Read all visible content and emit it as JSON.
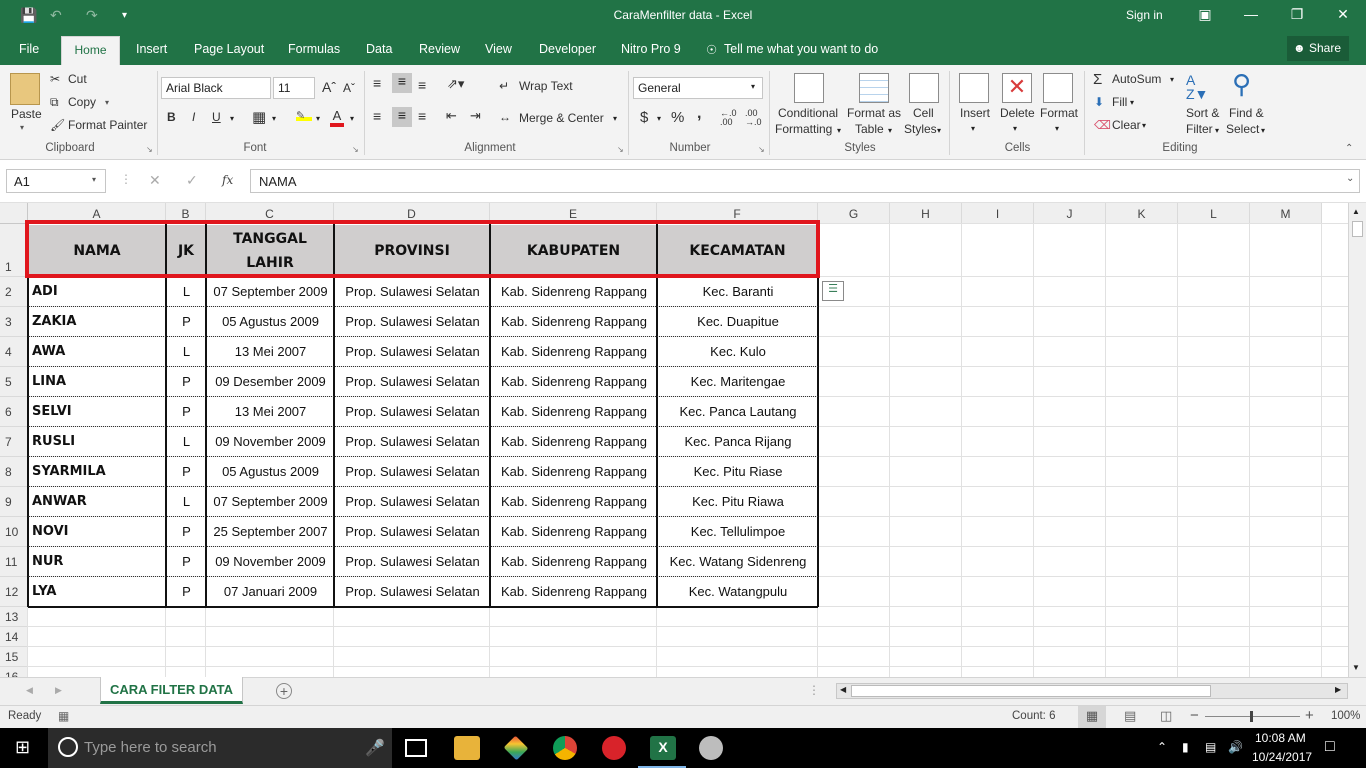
{
  "window": {
    "title": "CaraMenfilter data  -  Excel",
    "sign_in": "Sign in"
  },
  "tabs": [
    "File",
    "Home",
    "Insert",
    "Page Layout",
    "Formulas",
    "Data",
    "Review",
    "View",
    "Developer",
    "Nitro Pro 9"
  ],
  "tell_me": "Tell me what you want to do",
  "share": "Share",
  "ribbon": {
    "clipboard": {
      "paste": "Paste",
      "cut": "Cut",
      "copy": "Copy",
      "format_painter": "Format Painter",
      "label": "Clipboard"
    },
    "font": {
      "name": "Arial Black",
      "size": "11",
      "bold": "B",
      "italic": "I",
      "underline": "U",
      "label": "Font"
    },
    "alignment": {
      "wrap_text": "Wrap Text",
      "merge_center": "Merge & Center",
      "label": "Alignment"
    },
    "number": {
      "format": "General",
      "currency": "$",
      "percent": "%",
      "comma": ",",
      "label": "Number"
    },
    "styles": {
      "conditional": "Conditional",
      "conditional2": "Formatting",
      "format_as": "Format as",
      "format_as2": "Table",
      "cell": "Cell",
      "cell2": "Styles",
      "label": "Styles"
    },
    "cells": {
      "insert": "Insert",
      "delete": "Delete",
      "format": "Format",
      "label": "Cells"
    },
    "editing": {
      "autosum": "AutoSum",
      "fill": "Fill",
      "clear": "Clear",
      "sort": "Sort &",
      "sort2": "Filter",
      "find": "Find &",
      "find2": "Select",
      "label": "Editing"
    }
  },
  "formula_bar": {
    "name_box": "A1",
    "fx": "fx",
    "value": "NAMA"
  },
  "columns": [
    "A",
    "B",
    "C",
    "D",
    "E",
    "F",
    "G",
    "H",
    "I",
    "J",
    "K",
    "L",
    "M"
  ],
  "rows": [
    "1",
    "2",
    "3",
    "4",
    "5",
    "6",
    "7",
    "8",
    "9",
    "10",
    "11",
    "12",
    "13",
    "14",
    "15",
    "16"
  ],
  "table": {
    "headers": [
      "NAMA",
      "JK",
      "TANGGAL LAHIR",
      "PROVINSI",
      "KABUPATEN",
      "KECAMATAN"
    ],
    "data": [
      [
        "ADI",
        "L",
        "07 September 2009",
        "Prop. Sulawesi Selatan",
        "Kab. Sidenreng Rappang",
        "Kec. Baranti"
      ],
      [
        "ZAKIA",
        "P",
        "05 Agustus 2009",
        "Prop. Sulawesi Selatan",
        "Kab. Sidenreng Rappang",
        "Kec. Duapitue"
      ],
      [
        "AWA",
        "L",
        "13 Mei 2007",
        "Prop. Sulawesi Selatan",
        "Kab. Sidenreng Rappang",
        "Kec. Kulo"
      ],
      [
        "LINA",
        "P",
        "09 Desember 2009",
        "Prop. Sulawesi Selatan",
        "Kab. Sidenreng Rappang",
        "Kec. Maritengae"
      ],
      [
        "SELVI",
        "P",
        "13 Mei 2007",
        "Prop. Sulawesi Selatan",
        "Kab. Sidenreng Rappang",
        "Kec. Panca Lautang"
      ],
      [
        "RUSLI",
        "L",
        "09 November 2009",
        "Prop. Sulawesi Selatan",
        "Kab. Sidenreng Rappang",
        "Kec. Panca Rijang"
      ],
      [
        "SYARMILA",
        "P",
        "05 Agustus 2009",
        "Prop. Sulawesi Selatan",
        "Kab. Sidenreng Rappang",
        "Kec. Pitu Riase"
      ],
      [
        "ANWAR",
        "L",
        "07 September 2009",
        "Prop. Sulawesi Selatan",
        "Kab. Sidenreng Rappang",
        "Kec. Pitu Riawa"
      ],
      [
        "NOVI",
        "P",
        "25 September 2007",
        "Prop. Sulawesi Selatan",
        "Kab. Sidenreng Rappang",
        "Kec. Tellulimpoe"
      ],
      [
        "NUR",
        "P",
        "09 November 2009",
        "Prop. Sulawesi Selatan",
        "Kab. Sidenreng Rappang",
        "Kec. Watang Sidenreng"
      ],
      [
        "LYA",
        "P",
        "07 Januari 2009",
        "Prop. Sulawesi Selatan",
        "Kab. Sidenreng Rappang",
        "Kec. Watangpulu"
      ]
    ]
  },
  "sheet_tab": "CARA FILTER DATA",
  "status": {
    "ready": "Ready",
    "count": "Count: 6",
    "zoom": "100%"
  },
  "taskbar": {
    "search": "Type here to search",
    "time": "10:08 AM",
    "date": "10/24/2017"
  },
  "colors": {
    "excel_green": "#217346",
    "highlight_red": "#e0161d",
    "header_fill": "#d0cece"
  }
}
